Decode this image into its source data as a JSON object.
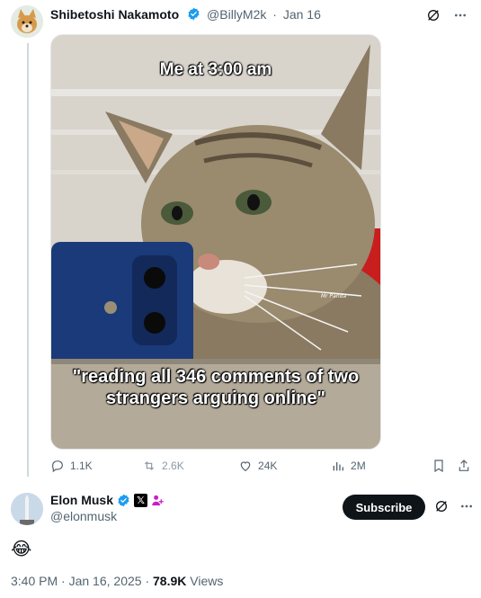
{
  "quoted_tweet": {
    "author_name": "Shibetoshi Nakamoto",
    "handle": "@BillyM2k",
    "date": "Jan 16",
    "verified": true,
    "meme_top_text": "Me at 3:00 am",
    "meme_bottom_text": "\"reading all 346 comments of two strangers arguing online\"",
    "watermark": "Mr Panda",
    "stats": {
      "replies": "1.1K",
      "reposts": "2.6K",
      "likes": "24K",
      "views": "2M"
    }
  },
  "main_tweet": {
    "author_name": "Elon Musk",
    "handle": "@elonmusk",
    "verified": true,
    "subscribe_label": "Subscribe",
    "text": "😂",
    "time": "3:40 PM",
    "date": "Jan 16, 2025",
    "views_count": "78.9K",
    "views_label": "Views"
  },
  "icons": [
    "grok-icon",
    "more-icon",
    "reply-icon",
    "retweet-icon",
    "like-icon",
    "views-icon",
    "bookmark-icon",
    "share-icon",
    "verified-icon",
    "x-badge-icon",
    "affiliate-icon"
  ],
  "colors": {
    "accent": "#1d9bf0",
    "text": "#0f1419",
    "muted": "#536471",
    "button": "#0f1419"
  }
}
